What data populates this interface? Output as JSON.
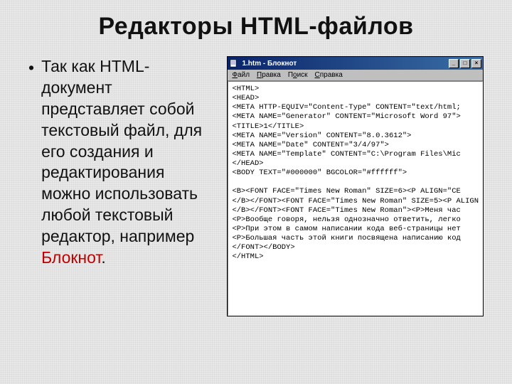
{
  "heading": "Редакторы HTML-файлов",
  "bullet": {
    "pre": "Так как HTML-документ представляет собой текстовый файл, для его создания и редактирования можно использовать любой текстовый редактор, например ",
    "highlight": "Блокнот",
    "post": "."
  },
  "window": {
    "title": "1.htm - Блокнот",
    "minimize": "_",
    "maximize": "□",
    "close": "×"
  },
  "menus": {
    "file": "Файл",
    "edit": "Правка",
    "search": "Поиск",
    "help": "Справка"
  },
  "code": {
    "l01": "<HTML>",
    "l02": "<HEAD>",
    "l03": "<META HTTP-EQUIV=\"Content-Type\" CONTENT=\"text/html;",
    "l04": "<META NAME=\"Generator\" CONTENT=\"Microsoft Word 97\">",
    "l05": "<TITLE>1</TITLE>",
    "l06": "<META NAME=\"Version\" CONTENT=\"8.0.3612\">",
    "l07": "<META NAME=\"Date\" CONTENT=\"3/4/97\">",
    "l08": "<META NAME=\"Template\" CONTENT=\"C:\\Program Files\\Mic",
    "l09": "</HEAD>",
    "l10": "<BODY TEXT=\"#000000\" BGCOLOR=\"#ffffff\">",
    "l11": "",
    "l12": "<B><FONT FACE=\"Times New Roman\" SIZE=6><P ALIGN=\"CE",
    "l13": "</B></FONT><FONT FACE=\"Times New Roman\" SIZE=5><P ALIGN",
    "l14": "</B></FONT><FONT FACE=\"Times New Roman\"><P>Меня час",
    "l15": "<P>Вообще говоря, нельзя однозначно ответить, легко",
    "l16": "<P>При этом в самом написании кода веб-страницы нет",
    "l17": "<P>Большая часть этой книги посвящена написанию код",
    "l18": "</FONT></BODY>",
    "l19": "</HTML>"
  }
}
